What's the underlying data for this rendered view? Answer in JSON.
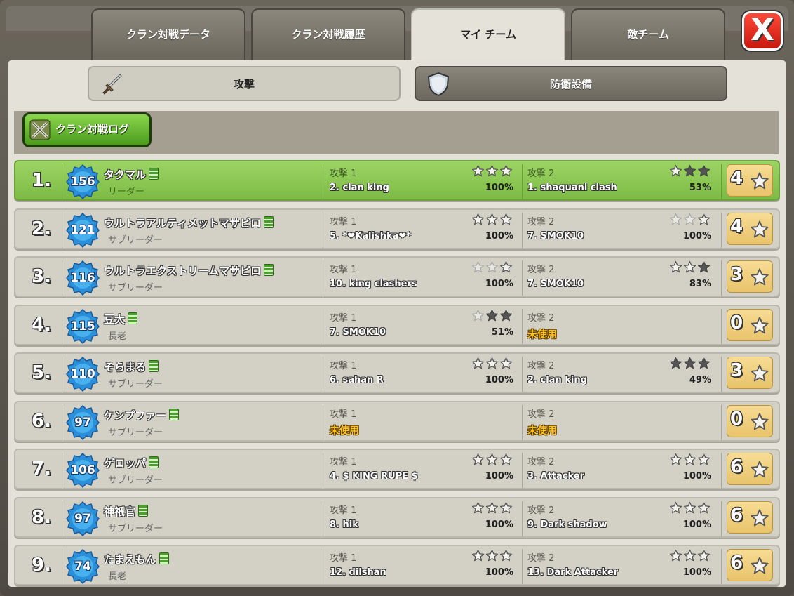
{
  "tabs": [
    {
      "label": "クラン対戦データ",
      "active": false
    },
    {
      "label": "クラン対戦履歴",
      "active": false
    },
    {
      "label": "マイ チーム",
      "active": true
    },
    {
      "label": "敵チーム",
      "active": false
    }
  ],
  "close_label": "X",
  "subtabs": {
    "attack": "攻撃",
    "defense": "防衛設備"
  },
  "war_log_button": "クラン対戦ログ",
  "colors": {
    "highlight": "#8cc752",
    "unused": "#ffc21a",
    "badge": "#2a8fd8",
    "star_total": "#f2d27d"
  },
  "members": [
    {
      "rank": "1.",
      "level": "156",
      "name": "タクマル",
      "role": "リーダー",
      "highlight": true,
      "attacks": [
        {
          "label": "攻撃 1",
          "target": "2. clan king",
          "pct": "100%",
          "stars": [
            0,
            0,
            0
          ],
          "new": [
            1,
            1,
            1
          ],
          "unused": ""
        },
        {
          "label": "攻撃 2",
          "target": "1. shaquani clash",
          "pct": "53%",
          "stars": [
            0,
            1,
            1
          ],
          "new": [
            1,
            0,
            0
          ],
          "unused": ""
        }
      ],
      "total": "4"
    },
    {
      "rank": "2.",
      "level": "121",
      "name": "ウルトラアルティメットマサピロ",
      "role": "サブリーダー",
      "highlight": false,
      "attacks": [
        {
          "label": "攻撃 1",
          "target": "5. *❤Kalishka❤*",
          "pct": "100%",
          "stars": [
            0,
            0,
            0
          ],
          "new": [
            1,
            1,
            1
          ],
          "unused": ""
        },
        {
          "label": "攻撃 2",
          "target": "7. SMOK10",
          "pct": "100%",
          "stars": [
            0,
            0,
            0
          ],
          "new": [
            0,
            0,
            1
          ],
          "unused": ""
        }
      ],
      "total": "4"
    },
    {
      "rank": "3.",
      "level": "116",
      "name": "ウルトラエクストリームマサピロ",
      "role": "サブリーダー",
      "highlight": false,
      "attacks": [
        {
          "label": "攻撃 1",
          "target": "10. king clashers",
          "pct": "100%",
          "stars": [
            0,
            0,
            0
          ],
          "new": [
            0,
            0,
            1
          ],
          "unused": ""
        },
        {
          "label": "攻撃 2",
          "target": "7. SMOK10",
          "pct": "83%",
          "stars": [
            0,
            0,
            1
          ],
          "new": [
            1,
            1,
            0
          ],
          "unused": ""
        }
      ],
      "total": "3"
    },
    {
      "rank": "4.",
      "level": "115",
      "name": "豆大",
      "role": "長老",
      "highlight": false,
      "attacks": [
        {
          "label": "攻撃 1",
          "target": "7. SMOK10",
          "pct": "51%",
          "stars": [
            0,
            1,
            1
          ],
          "new": [
            0,
            0,
            0
          ],
          "unused": ""
        },
        {
          "label": "攻撃 2",
          "target": "",
          "pct": "",
          "stars": [],
          "new": [],
          "unused": "未使用"
        }
      ],
      "total": "0"
    },
    {
      "rank": "5.",
      "level": "110",
      "name": "そらまる",
      "role": "サブリーダー",
      "highlight": false,
      "attacks": [
        {
          "label": "攻撃 1",
          "target": "6. sahan R",
          "pct": "100%",
          "stars": [
            0,
            0,
            0
          ],
          "new": [
            1,
            1,
            1
          ],
          "unused": ""
        },
        {
          "label": "攻撃 2",
          "target": "2. clan king",
          "pct": "49%",
          "stars": [
            1,
            1,
            1
          ],
          "new": [
            0,
            0,
            0
          ],
          "unused": ""
        }
      ],
      "total": "3"
    },
    {
      "rank": "6.",
      "level": "97",
      "name": "ケンプファー",
      "role": "サブリーダー",
      "highlight": false,
      "attacks": [
        {
          "label": "攻撃 1",
          "target": "",
          "pct": "",
          "stars": [],
          "new": [],
          "unused": "未使用"
        },
        {
          "label": "攻撃 2",
          "target": "",
          "pct": "",
          "stars": [],
          "new": [],
          "unused": "未使用"
        }
      ],
      "total": "0"
    },
    {
      "rank": "7.",
      "level": "106",
      "name": "ゲロッパ",
      "role": "サブリーダー",
      "highlight": false,
      "attacks": [
        {
          "label": "攻撃 1",
          "target": "4. $ KING RUPE $",
          "pct": "100%",
          "stars": [
            0,
            0,
            0
          ],
          "new": [
            1,
            1,
            1
          ],
          "unused": ""
        },
        {
          "label": "攻撃 2",
          "target": "3. Attacker",
          "pct": "100%",
          "stars": [
            0,
            0,
            0
          ],
          "new": [
            1,
            1,
            1
          ],
          "unused": ""
        }
      ],
      "total": "6"
    },
    {
      "rank": "8.",
      "level": "97",
      "name": "神祇官",
      "role": "サブリーダー",
      "highlight": false,
      "attacks": [
        {
          "label": "攻撃 1",
          "target": "8. hik",
          "pct": "100%",
          "stars": [
            0,
            0,
            0
          ],
          "new": [
            1,
            1,
            1
          ],
          "unused": ""
        },
        {
          "label": "攻撃 2",
          "target": "9. Dark shadow",
          "pct": "100%",
          "stars": [
            0,
            0,
            0
          ],
          "new": [
            1,
            1,
            1
          ],
          "unused": ""
        }
      ],
      "total": "6"
    },
    {
      "rank": "9.",
      "level": "74",
      "name": "たまえもん",
      "role": "長老",
      "highlight": false,
      "attacks": [
        {
          "label": "攻撃 1",
          "target": "12. dilshan",
          "pct": "100%",
          "stars": [
            0,
            0,
            0
          ],
          "new": [
            1,
            1,
            1
          ],
          "unused": ""
        },
        {
          "label": "攻撃 2",
          "target": "13. Dark Attacker",
          "pct": "100%",
          "stars": [
            0,
            0,
            0
          ],
          "new": [
            1,
            1,
            1
          ],
          "unused": ""
        }
      ],
      "total": "6"
    }
  ]
}
